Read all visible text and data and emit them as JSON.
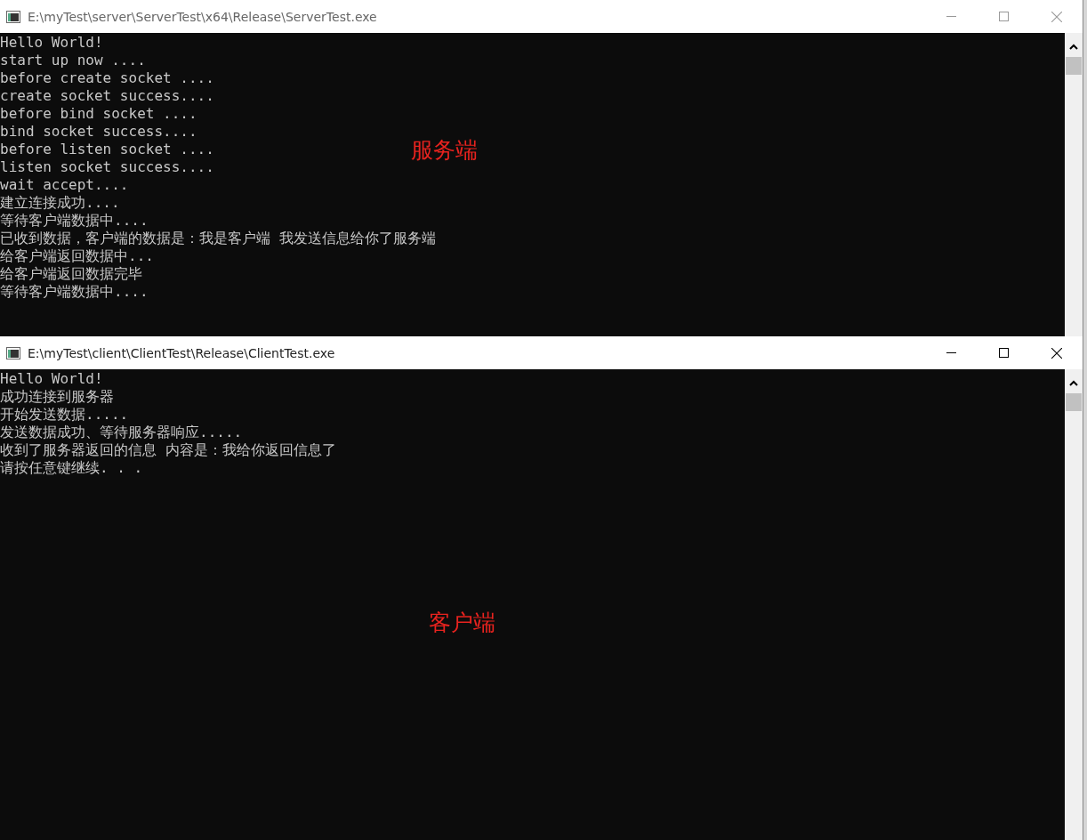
{
  "windows": [
    {
      "title": "E:\\myTest\\server\\ServerTest\\x64\\Release\\ServerTest.exe",
      "active": false,
      "kind": "server",
      "lines": [
        "Hello World!",
        "start up now ....",
        "before create socket ....",
        "create socket success....",
        "before bind socket ....",
        "bind socket success....",
        "before listen socket ....",
        "listen socket success....",
        "wait accept....",
        "建立连接成功....",
        "等待客户端数据中....",
        "已收到数据，客户端的数据是：我是客户端 我发送信息给你了服务端",
        "给客户端返回数据中...",
        "给客户端返回数据完毕",
        "等待客户端数据中...."
      ],
      "annotation": "服务端"
    },
    {
      "title": "E:\\myTest\\client\\ClientTest\\Release\\ClientTest.exe",
      "active": true,
      "kind": "client",
      "lines": [
        "Hello World!",
        "成功连接到服务器",
        "开始发送数据.....",
        "发送数据成功、等待服务器响应.....",
        "收到了服务器返回的信息 内容是：我给你返回信息了",
        "请按任意键继续. . ."
      ],
      "annotation": "客户端"
    }
  ]
}
